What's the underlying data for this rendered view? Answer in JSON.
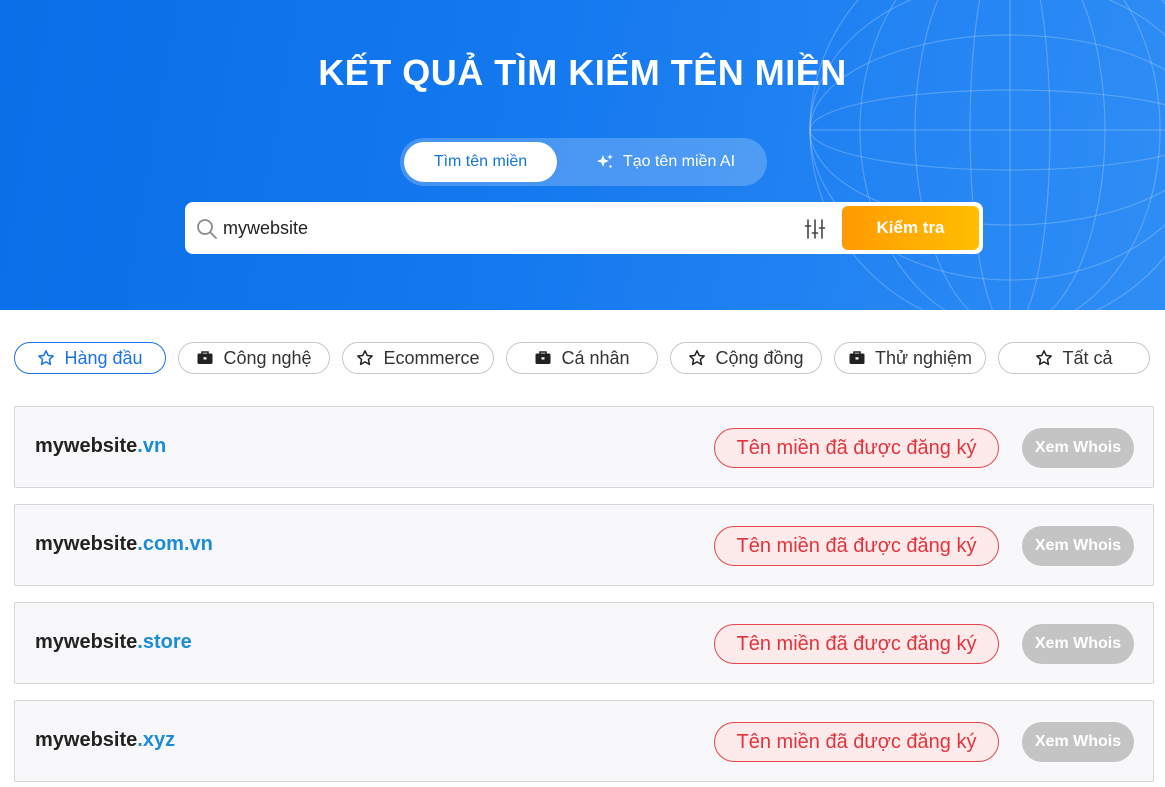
{
  "hero": {
    "title": "KẾT QUẢ TÌM KIẾM TÊN MIỀN",
    "tabs": {
      "find": "Tìm tên miền",
      "ai": "Tạo tên miền AI"
    },
    "search": {
      "value": "mywebsite",
      "button_label": "Kiểm tra"
    }
  },
  "categories": [
    {
      "label": "Hàng đầu",
      "icon": "star-icon",
      "active": true
    },
    {
      "label": "Công nghệ",
      "icon": "briefcase-icon"
    },
    {
      "label": "Ecommerce",
      "icon": "star-icon"
    },
    {
      "label": "Cá nhân",
      "icon": "briefcase-icon"
    },
    {
      "label": "Cộng đồng",
      "icon": "star-icon"
    },
    {
      "label": "Thử nghiệm",
      "icon": "briefcase-icon"
    },
    {
      "label": "Tất cả",
      "icon": "star-icon"
    }
  ],
  "results": [
    {
      "name": "mywebsite",
      "tld": ".vn",
      "status": "Tên miền đã được đăng ký",
      "action": "Xem Whois"
    },
    {
      "name": "mywebsite",
      "tld": ".com.vn",
      "status": "Tên miền đã được đăng ký",
      "action": "Xem Whois"
    },
    {
      "name": "mywebsite",
      "tld": ".store",
      "status": "Tên miền đã được đăng ký",
      "action": "Xem Whois"
    },
    {
      "name": "mywebsite",
      "tld": ".xyz",
      "status": "Tên miền đã được đăng ký",
      "action": "Xem Whois"
    }
  ],
  "colors": {
    "brand_blue": "#0a6fe8",
    "accent_orange": "#ff9a00",
    "status_red": "#e2343d",
    "tld_blue": "#1a8cd8"
  }
}
